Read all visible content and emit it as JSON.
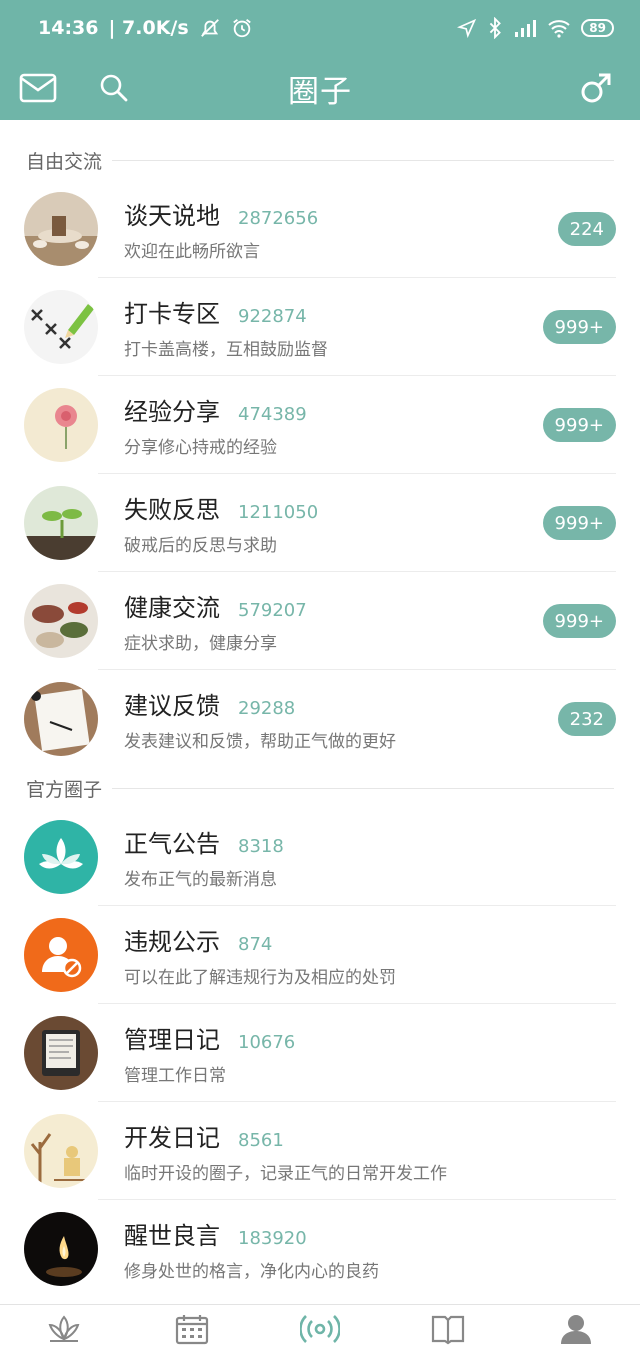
{
  "status_bar": {
    "time": "14:36",
    "speed": "| 7.0K/s",
    "battery": "89"
  },
  "app_bar": {
    "title": "圈子"
  },
  "sections": [
    {
      "title": "自由交流",
      "items": [
        {
          "name": "谈天说地",
          "count": "2872656",
          "desc": "欢迎在此畅所欲言",
          "badge": "224"
        },
        {
          "name": "打卡专区",
          "count": "922874",
          "desc": "打卡盖高楼，互相鼓励监督",
          "badge": "999+"
        },
        {
          "name": "经验分享",
          "count": "474389",
          "desc": "分享修心持戒的经验",
          "badge": "999+"
        },
        {
          "name": "失败反思",
          "count": "1211050",
          "desc": "破戒后的反思与求助",
          "badge": "999+"
        },
        {
          "name": "健康交流",
          "count": "579207",
          "desc": "症状求助，健康分享",
          "badge": "999+"
        },
        {
          "name": "建议反馈",
          "count": "29288",
          "desc": "发表建议和反馈，帮助正气做的更好",
          "badge": "232"
        }
      ]
    },
    {
      "title": "官方圈子",
      "items": [
        {
          "name": "正气公告",
          "count": "8318",
          "desc": "发布正气的最新消息"
        },
        {
          "name": "违规公示",
          "count": "874",
          "desc": "可以在此了解违规行为及相应的处罚"
        },
        {
          "name": "管理日记",
          "count": "10676",
          "desc": "管理工作日常"
        },
        {
          "name": "开发日记",
          "count": "8561",
          "desc": "临时开设的圈子，记录正气的日常开发工作"
        },
        {
          "name": "醒世良言",
          "count": "183920",
          "desc": "修身处世的格言，净化内心的良药"
        }
      ]
    }
  ],
  "bottom_nav": [
    {
      "icon": "lotus-icon"
    },
    {
      "icon": "calendar-icon"
    },
    {
      "icon": "broadcast-icon",
      "active": true
    },
    {
      "icon": "book-icon"
    },
    {
      "icon": "profile-icon"
    }
  ],
  "colors": {
    "accent": "#6fb5a8",
    "count_text": "#77b6a9"
  }
}
